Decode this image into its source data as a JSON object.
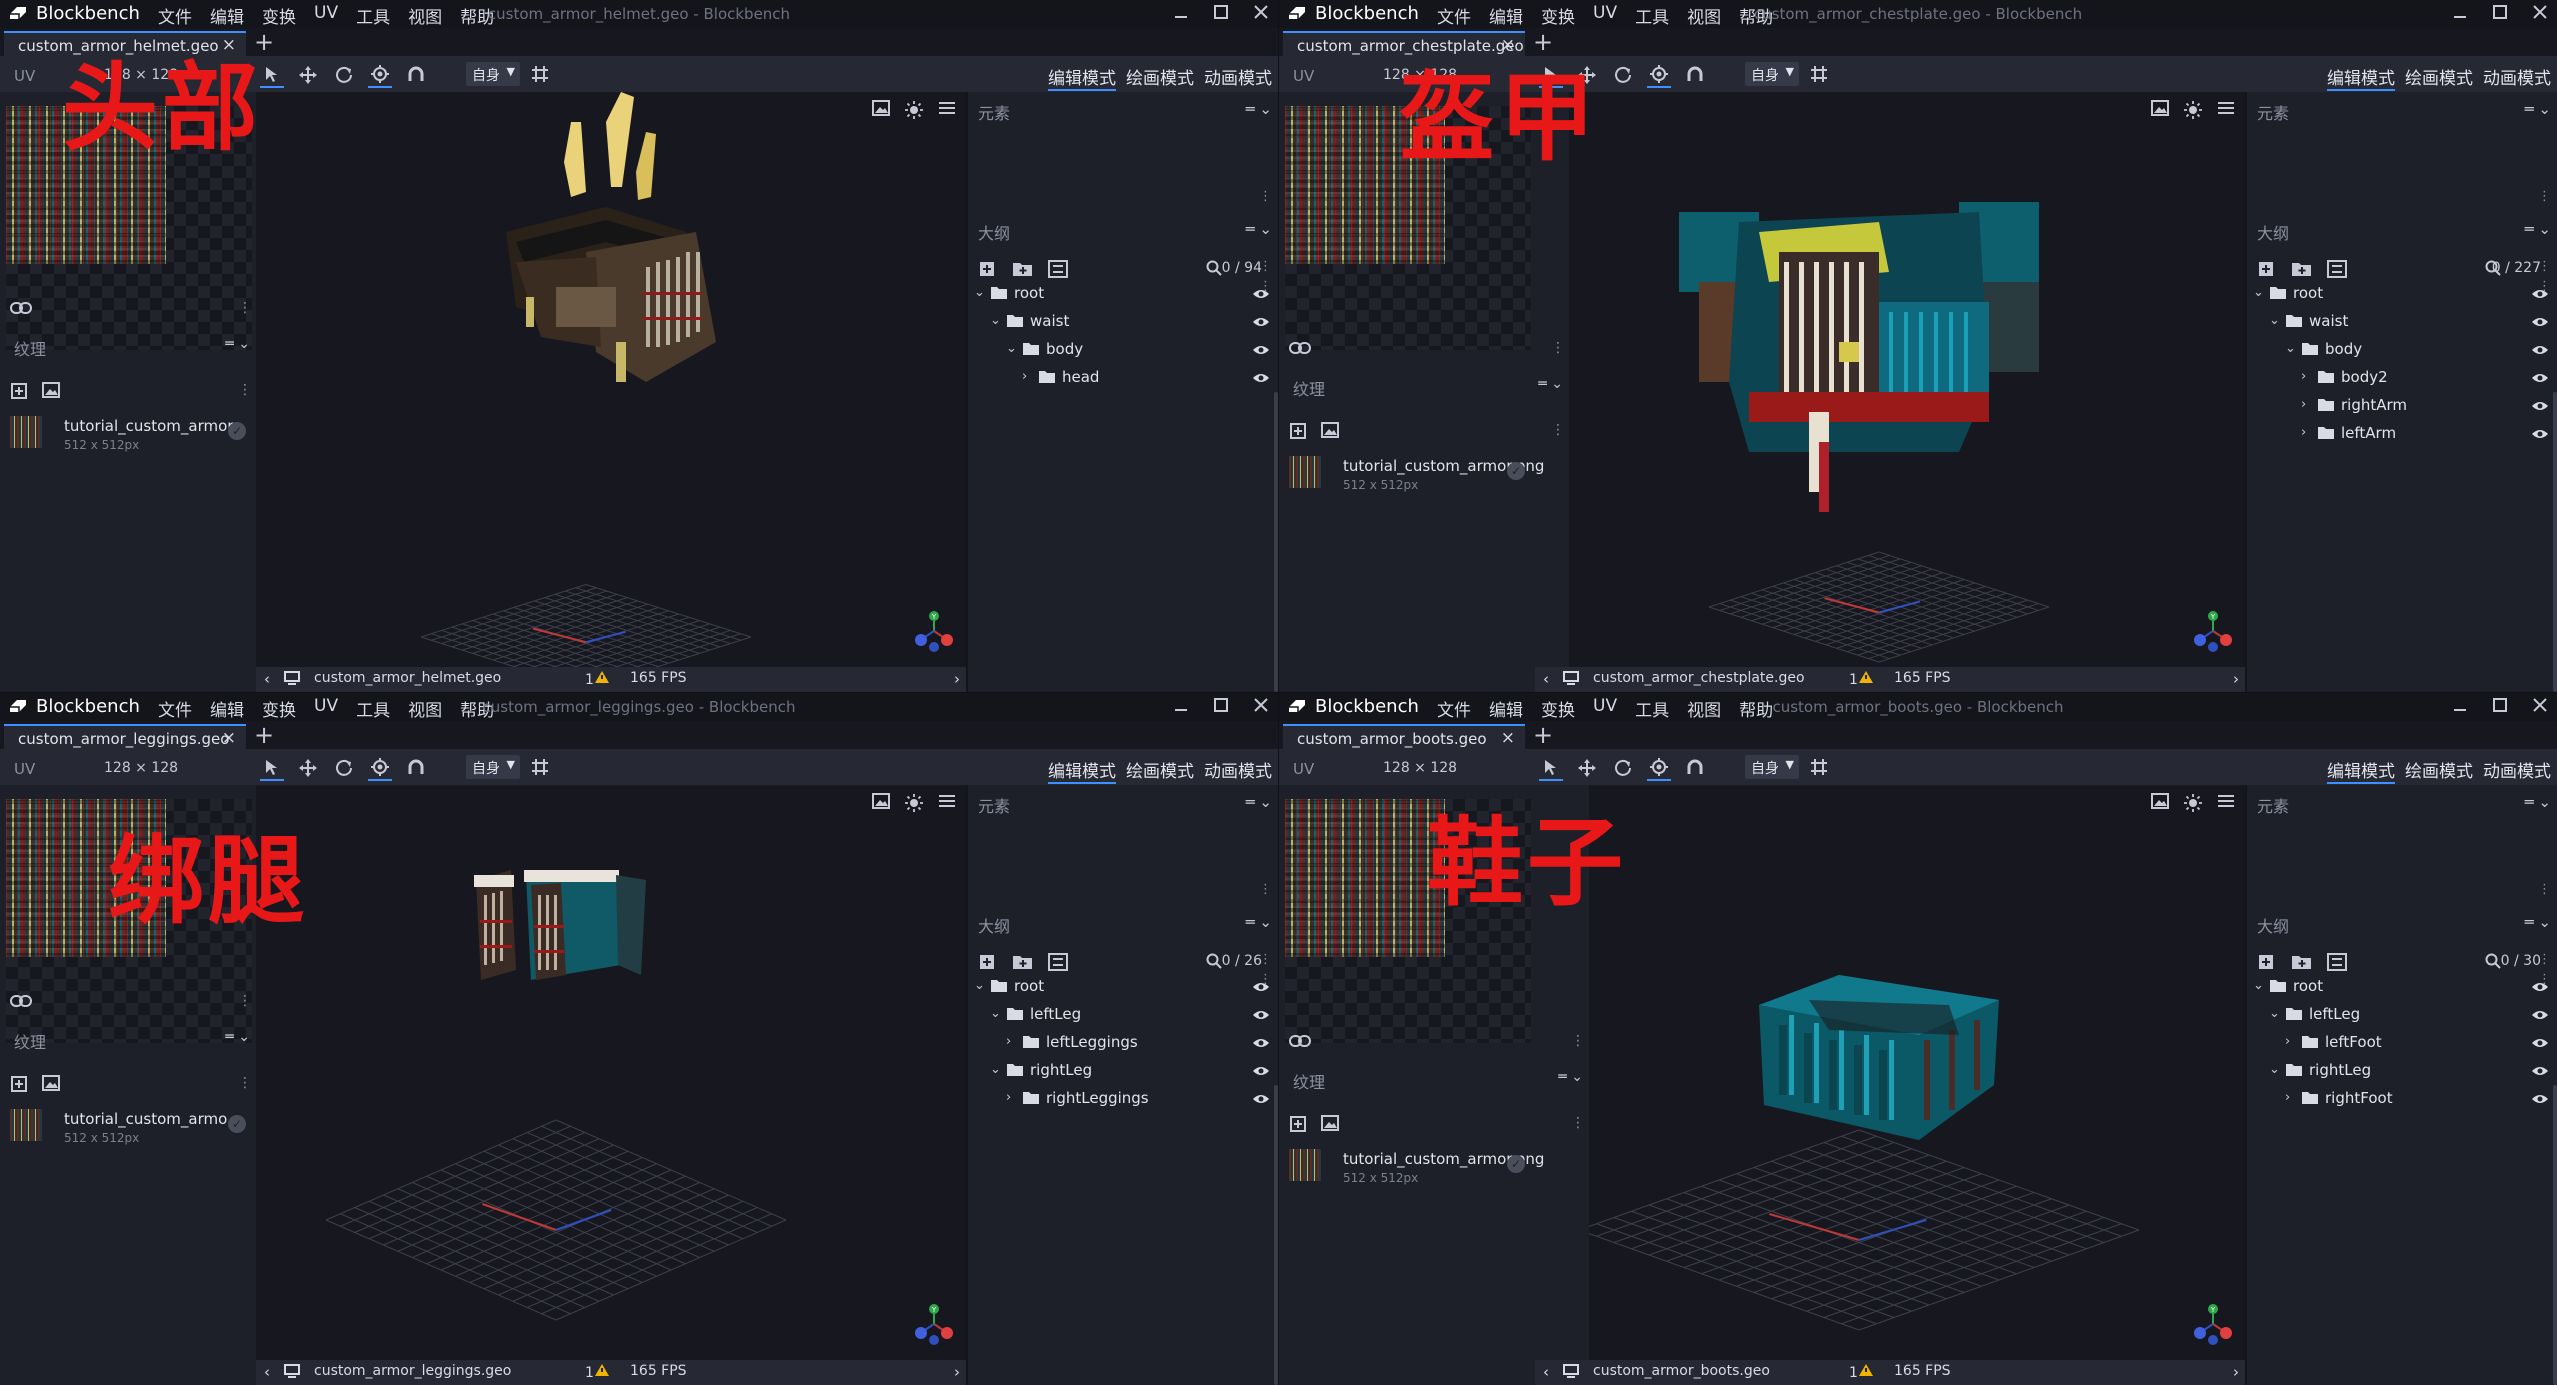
{
  "app_name": "Blockbench",
  "menu": [
    "文件",
    "编辑",
    "变换",
    "UV",
    "工具",
    "视图",
    "帮助"
  ],
  "toolbar": {
    "uv_label": "UV",
    "space": "自身",
    "modes": [
      "编辑模式",
      "绘画模式",
      "动画模式"
    ]
  },
  "panels": {
    "elements": "元素",
    "outliner": "大纲",
    "textures": "纹理"
  },
  "colors": {
    "accent": "#3e90ff",
    "overlay_text": "#e81818"
  },
  "windows": [
    {
      "window_title": "custom_armor_helmet.geo - Blockbench",
      "tab_label": "custom_armor_helmet.geo",
      "uv_size": "128 × 128",
      "texture_name": "tutorial_custom_armor",
      "texture_size": "512 x 512px",
      "status_file": "custom_armor_helmet.geo",
      "warnings": "1",
      "fps": "165 FPS",
      "outliner_count": "0 / 94",
      "overlay_label": "头部",
      "tree": [
        {
          "name": "root",
          "depth": 0,
          "expanded": true
        },
        {
          "name": "waist",
          "depth": 1,
          "expanded": true
        },
        {
          "name": "body",
          "depth": 2,
          "expanded": true
        },
        {
          "name": "head",
          "depth": 3,
          "expanded": false
        }
      ]
    },
    {
      "window_title": "custom_armor_chestplate.geo - Blockbench",
      "tab_label": "custom_armor_chestplate.geo",
      "uv_size": "128 × 128",
      "texture_name": "tutorial_custom_armor.png",
      "texture_size": "512 x 512px",
      "status_file": "custom_armor_chestplate.geo",
      "warnings": "1",
      "fps": "165 FPS",
      "outliner_count": "0 / 227",
      "overlay_label": "盔甲",
      "tree": [
        {
          "name": "root",
          "depth": 0,
          "expanded": true
        },
        {
          "name": "waist",
          "depth": 1,
          "expanded": true
        },
        {
          "name": "body",
          "depth": 2,
          "expanded": true
        },
        {
          "name": "body2",
          "depth": 3,
          "expanded": false
        },
        {
          "name": "rightArm",
          "depth": 3,
          "expanded": false
        },
        {
          "name": "leftArm",
          "depth": 3,
          "expanded": false
        }
      ]
    },
    {
      "window_title": "custom_armor_leggings.geo - Blockbench",
      "tab_label": "custom_armor_leggings.geo",
      "uv_size": "128 × 128",
      "texture_name": "tutorial_custom_armo",
      "texture_size": "512 x 512px",
      "status_file": "custom_armor_leggings.geo",
      "warnings": "1",
      "fps": "165 FPS",
      "outliner_count": "0 / 26",
      "overlay_label": "绑腿",
      "tree": [
        {
          "name": "root",
          "depth": 0,
          "expanded": true
        },
        {
          "name": "leftLeg",
          "depth": 1,
          "expanded": true
        },
        {
          "name": "leftLeggings",
          "depth": 2,
          "expanded": false
        },
        {
          "name": "rightLeg",
          "depth": 1,
          "expanded": true
        },
        {
          "name": "rightLeggings",
          "depth": 2,
          "expanded": false
        }
      ]
    },
    {
      "window_title": "custom_armor_boots.geo - Blockbench",
      "tab_label": "custom_armor_boots.geo",
      "uv_size": "128 × 128",
      "texture_name": "tutorial_custom_armor.png",
      "texture_size": "512 x 512px",
      "status_file": "custom_armor_boots.geo",
      "warnings": "1",
      "fps": "165 FPS",
      "outliner_count": "0 / 30",
      "overlay_label": "鞋子",
      "tree": [
        {
          "name": "root",
          "depth": 0,
          "expanded": true
        },
        {
          "name": "leftLeg",
          "depth": 1,
          "expanded": true
        },
        {
          "name": "leftFoot",
          "depth": 2,
          "expanded": false
        },
        {
          "name": "rightLeg",
          "depth": 1,
          "expanded": true
        },
        {
          "name": "rightFoot",
          "depth": 2,
          "expanded": false
        }
      ]
    }
  ]
}
